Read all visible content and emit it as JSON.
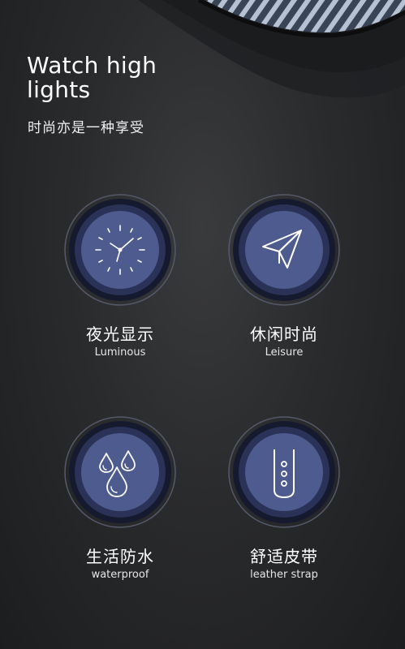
{
  "header": {
    "title": "Watch high lights",
    "subtitle": "时尚亦是一种享受"
  },
  "features": [
    {
      "cn": "夜光显示",
      "en": "Luminous",
      "icon": "clock-icon"
    },
    {
      "cn": "休闲时尚",
      "en": "Leisure",
      "icon": "paper-plane-icon"
    },
    {
      "cn": "生活防水",
      "en": "waterproof",
      "icon": "water-drops-icon"
    },
    {
      "cn": "舒适皮带",
      "en": "leather strap",
      "icon": "watch-strap-icon"
    }
  ],
  "colors": {
    "background": "#2a2b2d",
    "badge_fill": "#4e5b8f",
    "badge_ring": "#1d2240",
    "text": "#ffffff"
  }
}
